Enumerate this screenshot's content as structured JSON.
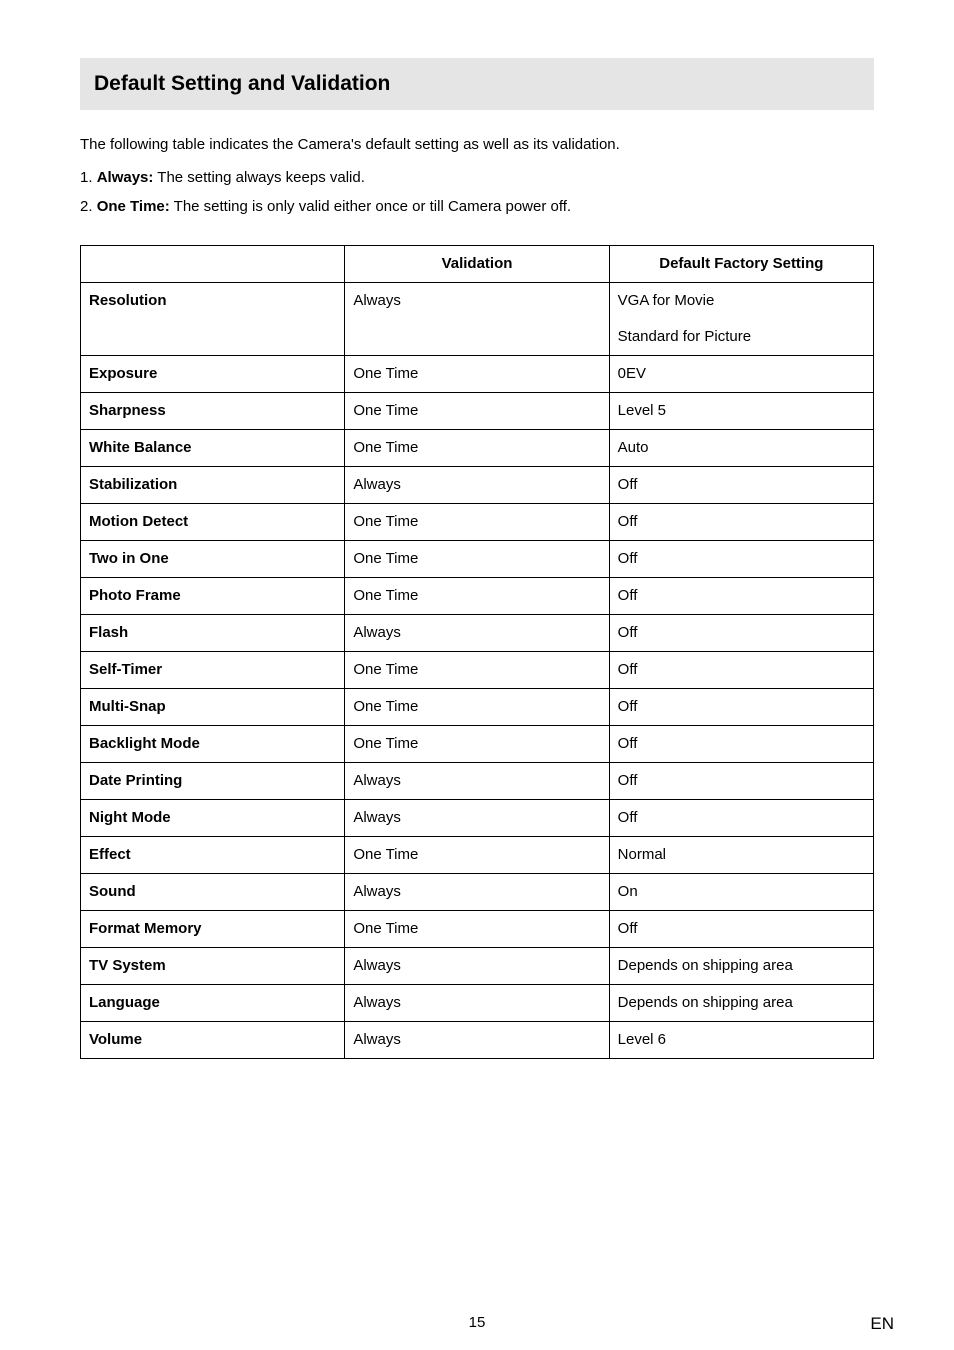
{
  "heading": "Default Setting and Validation",
  "intro": "The following table indicates the Camera's default setting as well as its validation.",
  "bullets": [
    {
      "num": "1. ",
      "bold": "Always:",
      "rest": " The setting always keeps valid."
    },
    {
      "num": "2. ",
      "bold": "One Time:",
      "rest": " The setting is only valid either once or till Camera power off."
    }
  ],
  "table": {
    "headers": [
      "",
      "Validation",
      "Default Factory Setting"
    ],
    "rows": [
      {
        "name": "Resolution",
        "validation": "Always",
        "default": "VGA for Movie",
        "default2": "Standard for Picture"
      },
      {
        "name": "Exposure",
        "validation": "One Time",
        "default": "0EV"
      },
      {
        "name": "Sharpness",
        "validation": "One Time",
        "default": "Level 5"
      },
      {
        "name": "White Balance",
        "validation": "One Time",
        "default": "Auto"
      },
      {
        "name": "Stabilization",
        "validation": "Always",
        "default": "Off"
      },
      {
        "name": "Motion Detect",
        "validation": "One Time",
        "default": "Off"
      },
      {
        "name": "Two in One",
        "validation": "One Time",
        "default": "Off"
      },
      {
        "name": "Photo Frame",
        "validation": "One Time",
        "default": "Off"
      },
      {
        "name": "Flash",
        "validation": "Always",
        "default": "Off"
      },
      {
        "name": "Self-Timer",
        "validation": "One Time",
        "default": "Off"
      },
      {
        "name": "Multi-Snap",
        "validation": "One Time",
        "default": "Off"
      },
      {
        "name": "Backlight Mode",
        "validation": "One Time",
        "default": "Off"
      },
      {
        "name": "Date Printing",
        "validation": "Always",
        "default": "Off"
      },
      {
        "name": "Night Mode",
        "validation": "Always",
        "default": "Off"
      },
      {
        "name": "Effect",
        "validation": "One Time",
        "default": "Normal"
      },
      {
        "name": "Sound",
        "validation": "Always",
        "default": "On"
      },
      {
        "name": "Format Memory",
        "validation": "One Time",
        "default": "Off"
      },
      {
        "name": "TV System",
        "validation": "Always",
        "default": "Depends on shipping area"
      },
      {
        "name": "Language",
        "validation": "Always",
        "default": "Depends on shipping area"
      },
      {
        "name": "Volume",
        "validation": "Always",
        "default": "Level 6"
      }
    ]
  },
  "footer": {
    "page": "15",
    "lang": "EN"
  }
}
